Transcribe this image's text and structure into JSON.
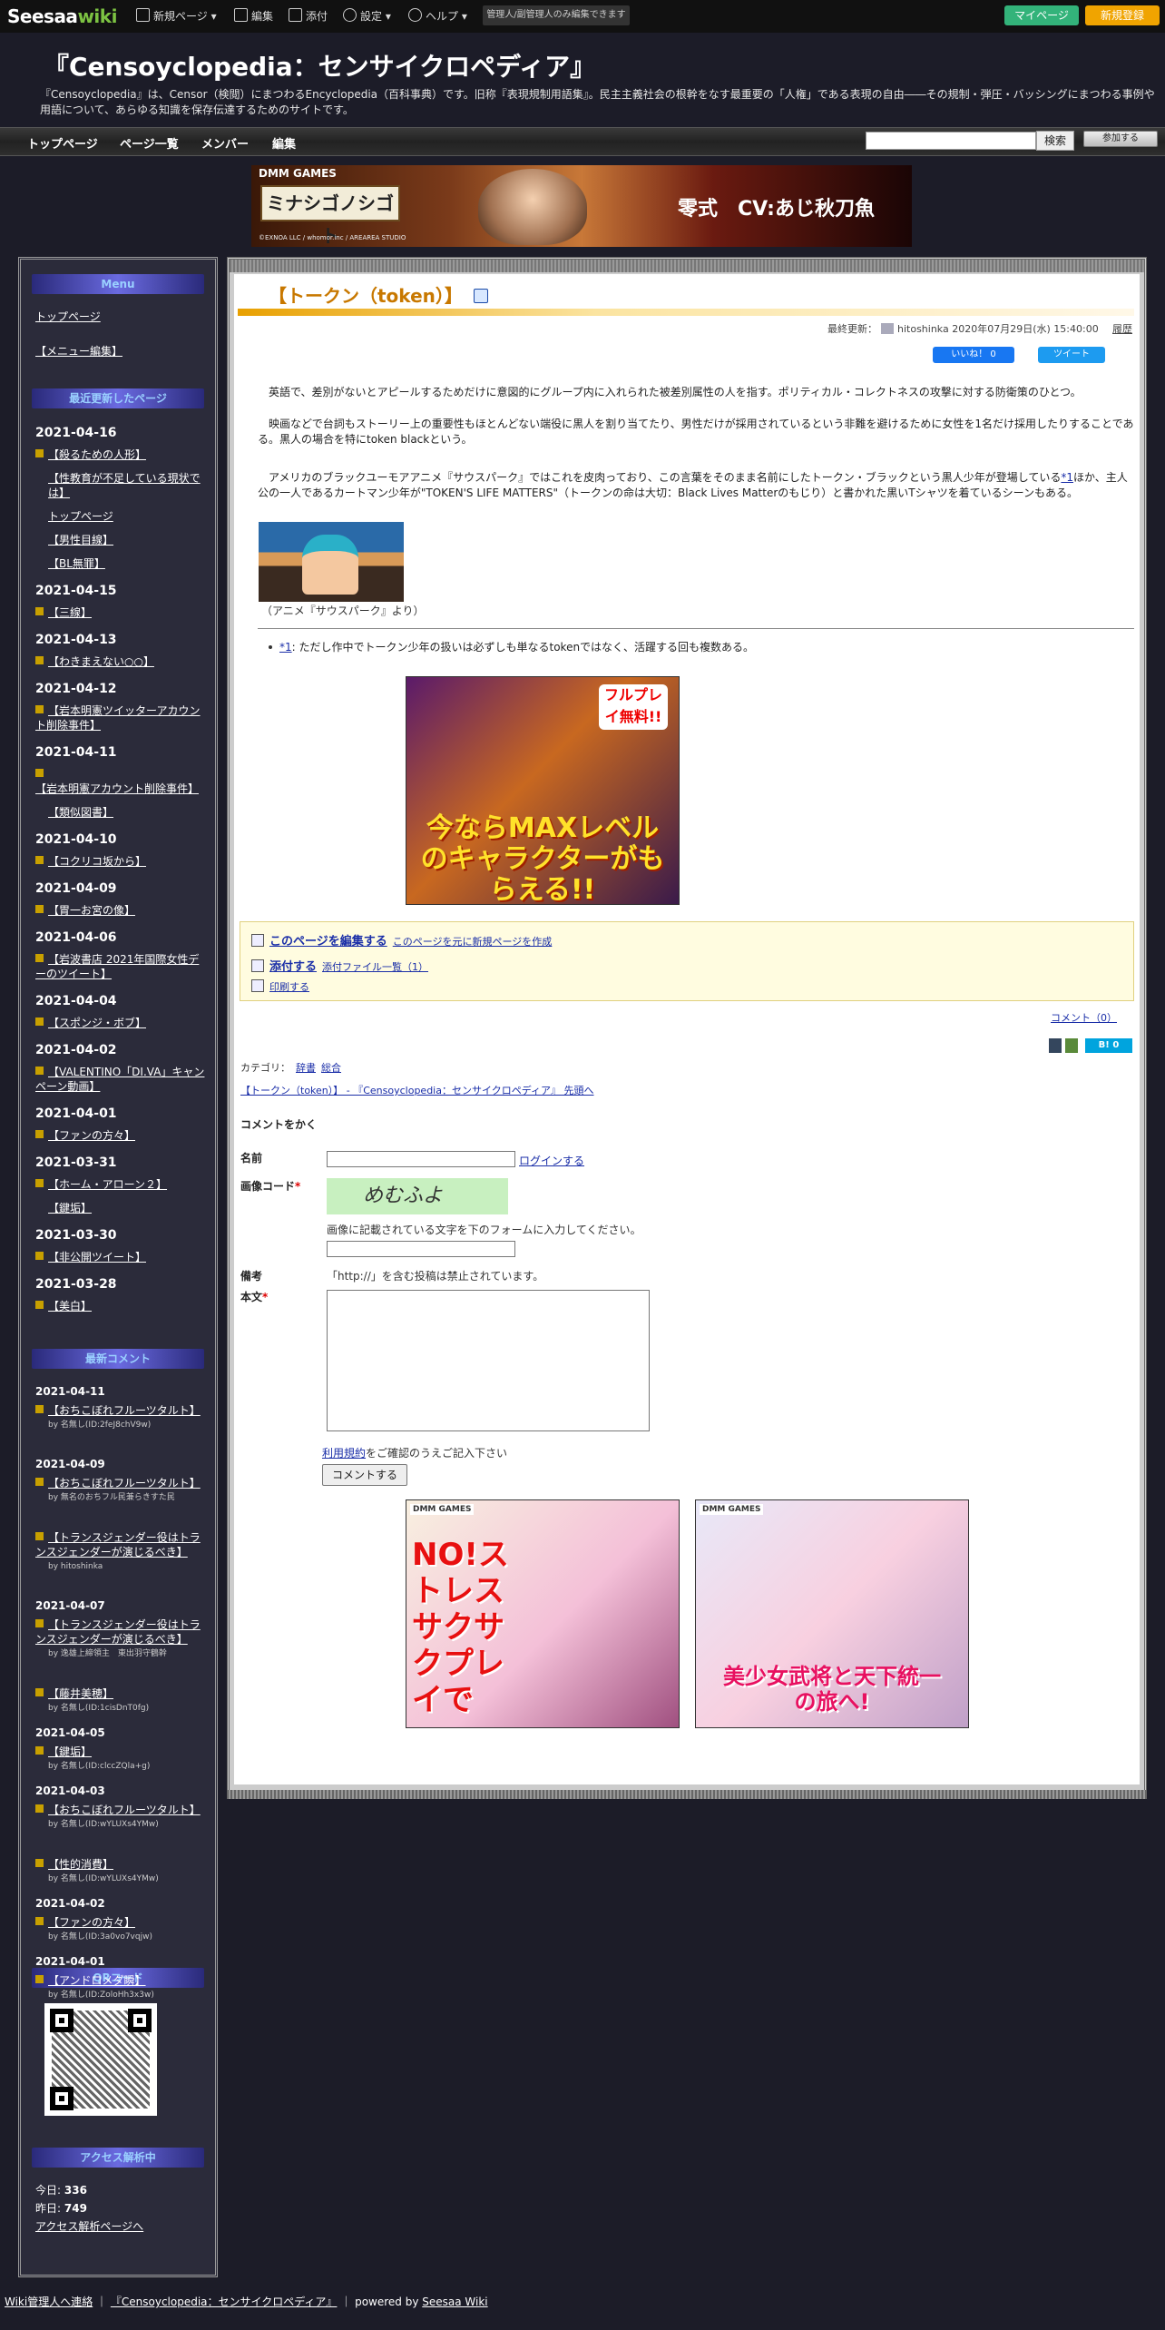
{
  "topbar": {
    "logo_main": "Seesaa",
    "logo_wiki": "wiki",
    "menu_new": "新規ページ",
    "menu_edit": "編集",
    "menu_attach": "添付",
    "menu_settings": "設定",
    "menu_help": "ヘルプ",
    "admin_notice": "管理人/副管理人のみ編集できます",
    "mypage": "マイページ",
    "register": "新規登録"
  },
  "header": {
    "title": "『Censoyclopedia：センサイクロペディア』",
    "description": "『Censoyclopedia』は、Censor（検閲）にまつわるEncyclopedia（百科事典）です。旧称『表現規制用語集』。民主主義社会の根幹をなす最重要の「人権」である表現の自由――その規制・弾圧・バッシングにまつわる事例や用語について、あらゆる知識を保存伝達するためのサイトです。"
  },
  "nav": {
    "top": "トップページ",
    "list": "ページ一覧",
    "members": "メンバー",
    "edit": "編集",
    "search_button": "検索",
    "join_button": "参加する"
  },
  "banner": {
    "brand": "DMM GAMES",
    "game": "ミナシゴノシゴト",
    "catch": "零式　CV:あじ秋刀魚",
    "copyright": "©EXNOA LLC / whomor.inc / AREAREA STUDIO"
  },
  "sidebar": {
    "menu_title": "Menu",
    "menu_links": [
      "トップページ",
      "【メニュー編集】"
    ],
    "recent_title": "最近更新したページ",
    "recent": [
      {
        "date": "2021-04-16",
        "items": [
          "【殺るための人形】",
          "【性教育が不足している現状では】",
          "トップページ",
          "【男性目線】",
          "【BL無罪】"
        ]
      },
      {
        "date": "2021-04-15",
        "items": [
          "【三線】"
        ]
      },
      {
        "date": "2021-04-13",
        "items": [
          "【わきまえない○○】"
        ]
      },
      {
        "date": "2021-04-12",
        "items": [
          "【岩本明憲ツイッターアカウント削除事件】"
        ]
      },
      {
        "date": "2021-04-11",
        "items": [
          "【岩本明憲アカウント削除事件】",
          "【類似図書】"
        ]
      },
      {
        "date": "2021-04-10",
        "items": [
          "【コクリコ坂から】"
        ]
      },
      {
        "date": "2021-04-09",
        "items": [
          "【胃一お宮の像】"
        ]
      },
      {
        "date": "2021-04-06",
        "items": [
          "【岩波書店 2021年国際女性デーのツイート】"
        ]
      },
      {
        "date": "2021-04-04",
        "items": [
          "【スポンジ・ボブ】"
        ]
      },
      {
        "date": "2021-04-02",
        "items": [
          "【VALENTINO「DI.VA」キャンペーン動画】"
        ]
      },
      {
        "date": "2021-04-01",
        "items": [
          "【ファンの方々】"
        ]
      },
      {
        "date": "2021-03-31",
        "items": [
          "【ホーム・アローン２】",
          "【鍵垢】"
        ]
      },
      {
        "date": "2021-03-30",
        "items": [
          "【非公開ツイート】"
        ]
      },
      {
        "date": "2021-03-28",
        "items": [
          "【美白】"
        ]
      }
    ],
    "comments_title": "最新コメント",
    "comments": [
      {
        "date": "2021-04-11",
        "items": [
          {
            "title": "【おちこぼれフルーツタルト】",
            "by": "by 名無し(ID:2feJ8chV9w)"
          }
        ]
      },
      {
        "date": "2021-04-09",
        "items": [
          {
            "title": "【おちこぼれフルーツタルト】",
            "by": "by 無名のおちフル民兼らきすた民"
          },
          {
            "title": "【トランスジェンダー役はトランスジェンダーが演じるべき】",
            "by": "by hitoshinka"
          }
        ]
      },
      {
        "date": "2021-04-07",
        "items": [
          {
            "title": "【トランスジェンダー役はトランスジェンダーが演じるべき】",
            "by": "by 逸雄上締領主　東出羽守鶴幹"
          },
          {
            "title": "【藤井美穂】",
            "by": "by 名無し(ID:1cisDnT0fg)"
          }
        ]
      },
      {
        "date": "2021-04-05",
        "items": [
          {
            "title": "【鍵垢】",
            "by": "by 名無し(ID:clccZQla+g)"
          }
        ]
      },
      {
        "date": "2021-04-03",
        "items": [
          {
            "title": "【おちこぼれフルーツタルト】",
            "by": "by 名無し(ID:wYLUXs4YMw)"
          },
          {
            "title": "【性的消費】",
            "by": "by 名無し(ID:wYLUXs4YMw)"
          }
        ]
      },
      {
        "date": "2021-04-02",
        "items": [
          {
            "title": "【ファンの方々】",
            "by": "by 名無し(ID:3a0vo7vqjw)"
          }
        ]
      },
      {
        "date": "2021-04-01",
        "items": [
          {
            "title": "【アンドロメダ瞬】",
            "by": "by 名無し(ID:ZoloHh3x3w)"
          }
        ]
      }
    ],
    "qr_title": "QRコード",
    "access_title": "アクセス解析中",
    "today_label": "今日:",
    "today_value": "336",
    "yesterday_label": "昨日:",
    "yesterday_value": "749",
    "access_link": "アクセス解析ページへ"
  },
  "page": {
    "title": "【トークン（token）】",
    "updated_label": "最終更新：",
    "updated_user": "hitoshinka",
    "updated_date": "2020年07月29日(水) 15:40:00",
    "history": "履歴",
    "like": "いいね！ 0",
    "tweet": "ツイート",
    "para1": "　英語で、差別がないとアピールするためだけに意図的にグループ内に入れられた被差別属性の人を指す。ポリティカル・コレクトネスの攻撃に対する防衛策のひとつ。",
    "para2": "　映画などで台詞もストーリー上の重要性もほとんどない端役に黒人を割り当てたり、男性だけが採用されているという非難を避けるために女性を1名だけ採用したりすることである。黒人の場合を特にtoken blackという。",
    "para3a": "　アメリカのブラックユーモアアニメ『サウスパーク』ではこれを皮肉っており、この言葉をそのまま名前にしたトークン・ブラックという黒人少年が登場している",
    "para3_ref": "*1",
    "para3b": "ほか、主人公の一人であるカートマン少年が\"TOKEN'S LIFE MATTERS\"（トークンの命は大切：Black Lives Matterのもじり）と書かれた黒いTシャツを着ているシーンもある。",
    "image_caption": "（アニメ『サウスパーク』より）",
    "footnote_ref": "*1",
    "footnote_text": ": ただし作中でトークン少年の扱いは必ずしも単なるtokenではなく、活躍する回も複数ある。"
  },
  "ad_mid": {
    "free": "フルプレイ無料!!",
    "catch": "今ならMAXレベルのキャラクターがもらえる!!"
  },
  "editbox": {
    "edit_main": "このページを編集する",
    "edit_sub": "このページを元に新規ページを作成",
    "attach_main": "添付する",
    "attach_sub": "添付ファイル一覧（1）",
    "print": "印刷する"
  },
  "comment_link": "コメント（0）",
  "share": {
    "hatena": "0"
  },
  "category": {
    "label": "カテゴリ：",
    "items": [
      "辞書",
      "総合"
    ]
  },
  "breadcrumb": "【トークン（token）】 - 『Censoyclopedia：センサイクロペディア』 先頭へ",
  "form": {
    "heading": "コメントをかく",
    "name_label": "名前",
    "login_link": "ログインする",
    "captcha_label": "画像コード",
    "captcha_text": "めむふよ",
    "captcha_note": "画像に記載されている文字を下のフォームに入力してください。",
    "remarks_label": "備考",
    "remarks_text": "「http://」を含む投稿は禁止されています。",
    "body_label": "本文",
    "terms_link": "利用規約",
    "terms_text": "をご確認のうえご記入下さい",
    "submit": "コメントする"
  },
  "ad_bottom": {
    "left_brand": "DMM GAMES",
    "left_catch": "NO!ストレス サクサクプレイで",
    "right_brand": "DMM GAMES",
    "right_catch": "美少女武将と天下統一の旅へ!"
  },
  "footer": {
    "contact": "Wiki管理人へ連絡",
    "site": "『Censoyclopedia：センサイクロペディア』",
    "powered": "powered by",
    "seesaa": "Seesaa Wiki"
  }
}
